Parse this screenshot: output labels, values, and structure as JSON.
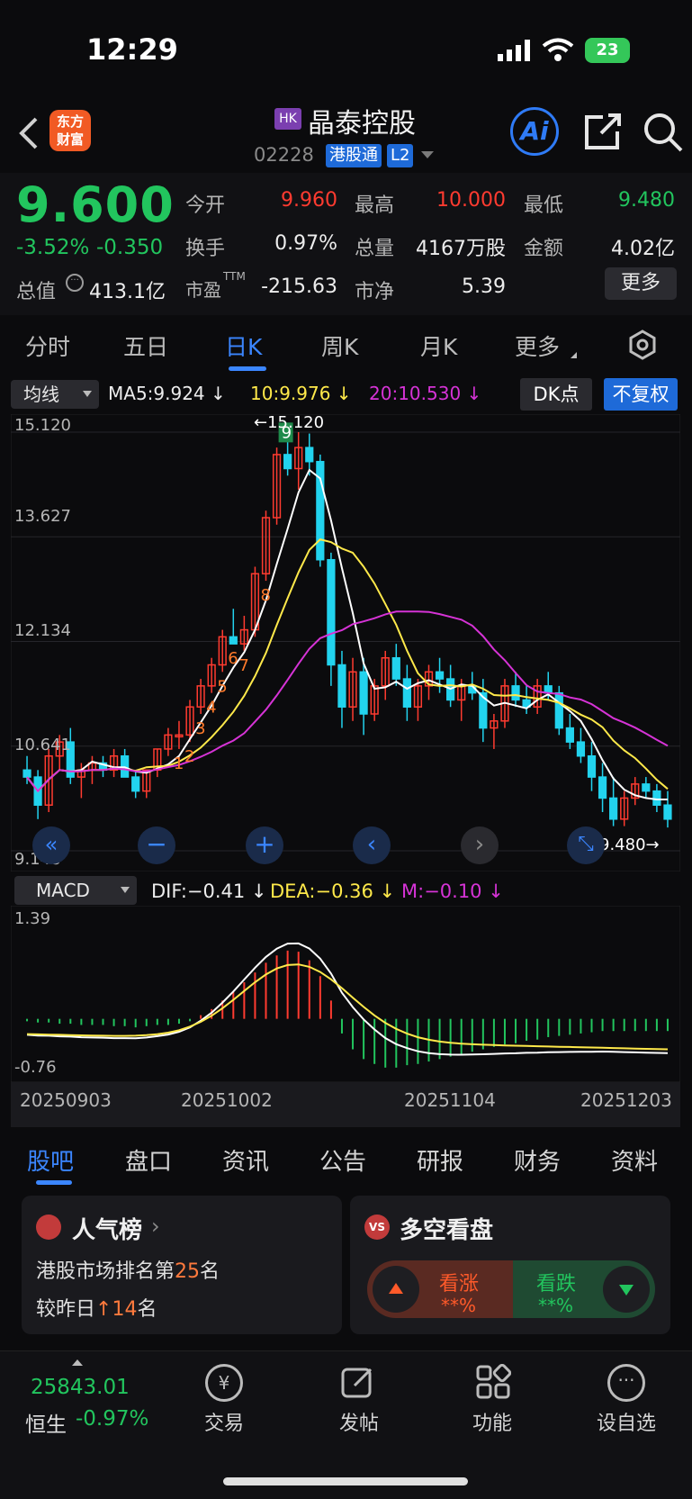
{
  "status_bar": {
    "time": "12:29",
    "battery": "23"
  },
  "header": {
    "logo_line1": "东方",
    "logo_line2": "财富",
    "market_tag": "HK",
    "stock_name": "晶泰控股",
    "stock_code": "02228",
    "connect_badge": "港股通",
    "level_badge": "L2",
    "ai_label": "Ai"
  },
  "quote": {
    "price": "9.600",
    "change_pct": "-3.52%",
    "change_amt": "-0.350",
    "open_label": "今开",
    "open": "9.960",
    "high_label": "最高",
    "high": "10.000",
    "low_label": "最低",
    "low": "9.480",
    "turnover_label": "换手",
    "turnover": "0.97%",
    "volume_label": "总量",
    "volume": "4167万股",
    "amount_label": "金额",
    "amount": "4.02亿",
    "mktcap_label": "总值",
    "mktcap": "413.1亿",
    "pe_label": "市盈",
    "pe_sup": "TTM",
    "pe": "-215.63",
    "pb_label": "市净",
    "pb": "5.39",
    "more_label": "更多"
  },
  "period_tabs": [
    "分时",
    "五日",
    "日K",
    "周K",
    "月K",
    "更多"
  ],
  "ma_legend": {
    "dropdown": "均线",
    "ma5": "MA5:9.924",
    "ma10": "10:9.976",
    "ma20": "20:10.530",
    "dk_label": "DK点",
    "adjust_label": "不复权"
  },
  "macd_legend": {
    "dropdown": "MACD",
    "dif": "DIF:−0.41",
    "dea": "DEA:−0.36",
    "m": "M:−0.10"
  },
  "colors": {
    "up": "#ff3b30",
    "down": "#22d3ee",
    "ma5": "#ffffff",
    "ma10": "#ffe94a",
    "ma20": "#d633d6",
    "accent": "#3b86ff"
  },
  "chart_data": [
    {
      "type": "candlestick",
      "title": "",
      "y_ticks": [
        "15.120",
        "13.627",
        "12.134",
        "10.641",
        "9.148"
      ],
      "ylim": [
        9.148,
        15.12
      ],
      "annotations": {
        "high_marker": "15.120",
        "low_marker": "9.480"
      },
      "td_counts_up": [
        "1",
        "2",
        "3",
        "4",
        "5",
        "6",
        "7",
        "8"
      ],
      "td_count_9": "9",
      "candles": [
        [
          10.3,
          10.5,
          10.1,
          10.2
        ],
        [
          10.2,
          10.3,
          9.6,
          9.8
        ],
        [
          9.8,
          10.6,
          9.7,
          10.5
        ],
        [
          10.5,
          10.8,
          10.3,
          10.7
        ],
        [
          10.7,
          10.9,
          10.1,
          10.2
        ],
        [
          10.2,
          10.4,
          9.9,
          10.3
        ],
        [
          10.3,
          10.5,
          10.1,
          10.4
        ],
        [
          10.4,
          10.5,
          10.2,
          10.3
        ],
        [
          10.3,
          10.6,
          10.2,
          10.5
        ],
        [
          10.5,
          10.6,
          10.2,
          10.2
        ],
        [
          10.2,
          10.3,
          9.9,
          10.0
        ],
        [
          10.0,
          10.3,
          9.9,
          10.3
        ],
        [
          10.3,
          10.6,
          10.2,
          10.6
        ],
        [
          10.6,
          10.9,
          10.5,
          10.8
        ],
        [
          10.8,
          11.0,
          10.6,
          10.8
        ],
        [
          10.8,
          11.3,
          10.7,
          11.2
        ],
        [
          11.2,
          11.6,
          11.1,
          11.5
        ],
        [
          11.5,
          11.9,
          11.4,
          11.8
        ],
        [
          11.8,
          12.3,
          11.7,
          12.2
        ],
        [
          12.2,
          12.6,
          12.1,
          12.1
        ],
        [
          12.1,
          12.5,
          12.0,
          12.3
        ],
        [
          12.3,
          13.2,
          12.2,
          13.1
        ],
        [
          13.1,
          14.0,
          13.0,
          13.9
        ],
        [
          13.9,
          14.9,
          13.8,
          14.8
        ],
        [
          14.8,
          15.0,
          14.5,
          14.6
        ],
        [
          14.6,
          15.12,
          14.3,
          14.9
        ],
        [
          14.9,
          15.1,
          14.5,
          14.7
        ],
        [
          14.7,
          14.8,
          13.2,
          13.3
        ],
        [
          13.3,
          13.4,
          11.5,
          11.8
        ],
        [
          11.8,
          12.0,
          10.9,
          11.2
        ],
        [
          11.2,
          11.9,
          11.0,
          11.7
        ],
        [
          11.7,
          11.9,
          10.8,
          11.1
        ],
        [
          11.1,
          11.6,
          11.0,
          11.5
        ],
        [
          11.5,
          12.0,
          11.3,
          11.9
        ],
        [
          11.9,
          12.1,
          11.5,
          11.6
        ],
        [
          11.6,
          11.8,
          11.0,
          11.2
        ],
        [
          11.2,
          11.6,
          11.0,
          11.5
        ],
        [
          11.5,
          11.8,
          11.3,
          11.7
        ],
        [
          11.7,
          11.9,
          11.4,
          11.6
        ],
        [
          11.6,
          11.8,
          11.2,
          11.3
        ],
        [
          11.3,
          11.6,
          11.0,
          11.5
        ],
        [
          11.5,
          11.7,
          11.3,
          11.4
        ],
        [
          11.4,
          11.6,
          10.7,
          10.9
        ],
        [
          10.9,
          11.1,
          10.6,
          11.0
        ],
        [
          11.0,
          11.6,
          10.9,
          11.5
        ],
        [
          11.5,
          11.7,
          11.2,
          11.3
        ],
        [
          11.3,
          11.5,
          11.1,
          11.2
        ],
        [
          11.2,
          11.6,
          11.1,
          11.5
        ],
        [
          11.5,
          11.7,
          11.3,
          11.4
        ],
        [
          11.4,
          11.5,
          10.8,
          10.9
        ],
        [
          10.9,
          11.1,
          10.6,
          10.7
        ],
        [
          10.7,
          10.9,
          10.4,
          10.5
        ],
        [
          10.5,
          10.7,
          10.0,
          10.2
        ],
        [
          10.2,
          10.4,
          9.7,
          9.9
        ],
        [
          9.9,
          10.2,
          9.5,
          9.6
        ],
        [
          9.6,
          10.0,
          9.5,
          9.9
        ],
        [
          9.9,
          10.2,
          9.8,
          10.1
        ],
        [
          10.1,
          10.2,
          9.9,
          10.0
        ],
        [
          10.0,
          10.1,
          9.7,
          9.8
        ],
        [
          9.8,
          10.0,
          9.48,
          9.6
        ]
      ]
    },
    {
      "type": "bar",
      "title": "",
      "y_ticks": [
        "1.39",
        "-0.76"
      ],
      "ylim": [
        -0.76,
        1.39
      ],
      "macd_values": [
        -0.02,
        -0.03,
        -0.03,
        -0.04,
        -0.04,
        -0.05,
        -0.05,
        -0.05,
        -0.06,
        -0.06,
        -0.07,
        -0.06,
        -0.05,
        -0.05,
        -0.04,
        -0.02,
        0.03,
        0.08,
        0.15,
        0.22,
        0.3,
        0.38,
        0.46,
        0.52,
        0.56,
        0.55,
        0.48,
        0.35,
        0.15,
        -0.12,
        -0.25,
        -0.33,
        -0.37,
        -0.4,
        -0.4,
        -0.38,
        -0.37,
        -0.35,
        -0.33,
        -0.31,
        -0.29,
        -0.27,
        -0.25,
        -0.23,
        -0.21,
        -0.2,
        -0.18,
        -0.17,
        -0.15,
        -0.14,
        -0.13,
        -0.12,
        -0.11,
        -0.1,
        -0.1,
        -0.1,
        -0.1,
        -0.1,
        -0.1,
        -0.1
      ],
      "x_ticks": [
        "20250903",
        "20251002",
        "20251104",
        "20251203"
      ]
    }
  ],
  "sub_tabs": [
    "股吧",
    "盘口",
    "资讯",
    "公告",
    "研报",
    "财务",
    "资料"
  ],
  "popularity": {
    "title": "人气榜",
    "rank_prefix": "港股市场排名第",
    "rank": "25",
    "rank_suffix": "名",
    "change_prefix": "较昨日",
    "change": "14",
    "change_suffix": "名"
  },
  "sentiment": {
    "title": "多空看盘",
    "bull_label": "看涨",
    "bull_value": "**%",
    "bear_label": "看跌",
    "bear_value": "**%"
  },
  "bottom_nav": {
    "index_value": "25843.01",
    "index_name": "恒生",
    "index_change": "-0.97%",
    "items": [
      "交易",
      "发帖",
      "功能",
      "设自选"
    ]
  }
}
